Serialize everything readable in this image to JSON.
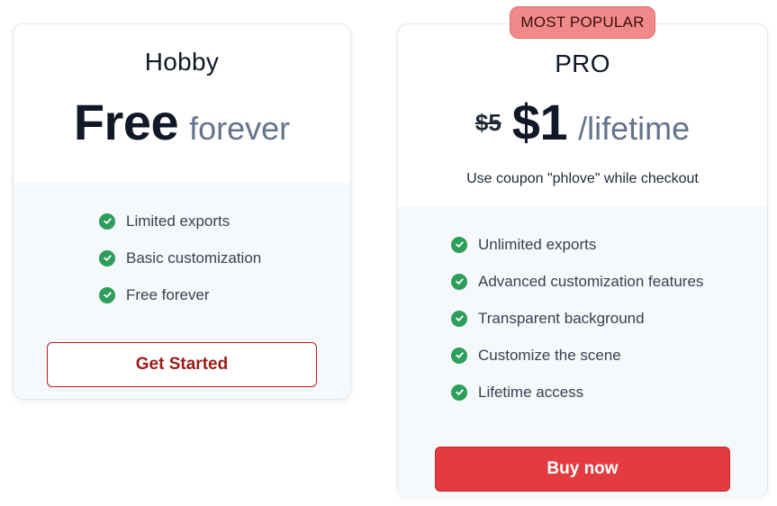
{
  "hobby": {
    "title": "Hobby",
    "price": "Free",
    "price_suffix": "forever",
    "features": [
      "Limited exports",
      "Basic customization",
      "Free forever"
    ],
    "button_label": "Get Started"
  },
  "pro": {
    "badge": "MOST POPULAR",
    "title": "PRO",
    "old_price": "$5",
    "price": "$1",
    "price_suffix": "/lifetime",
    "coupon": "Use coupon \"phlove\" while checkout",
    "features": [
      "Unlimited exports",
      "Advanced customization features",
      "Transparent background",
      "Customize the scene",
      "Lifetime access"
    ],
    "button_label": "Buy now"
  },
  "colors": {
    "accent_red": "#e33b3f",
    "badge_bg": "#f08a8a",
    "check_green": "#2e9e5b",
    "feature_bg": "#f6f9fc"
  },
  "icons": {
    "feature_check": "check-circle-icon"
  }
}
